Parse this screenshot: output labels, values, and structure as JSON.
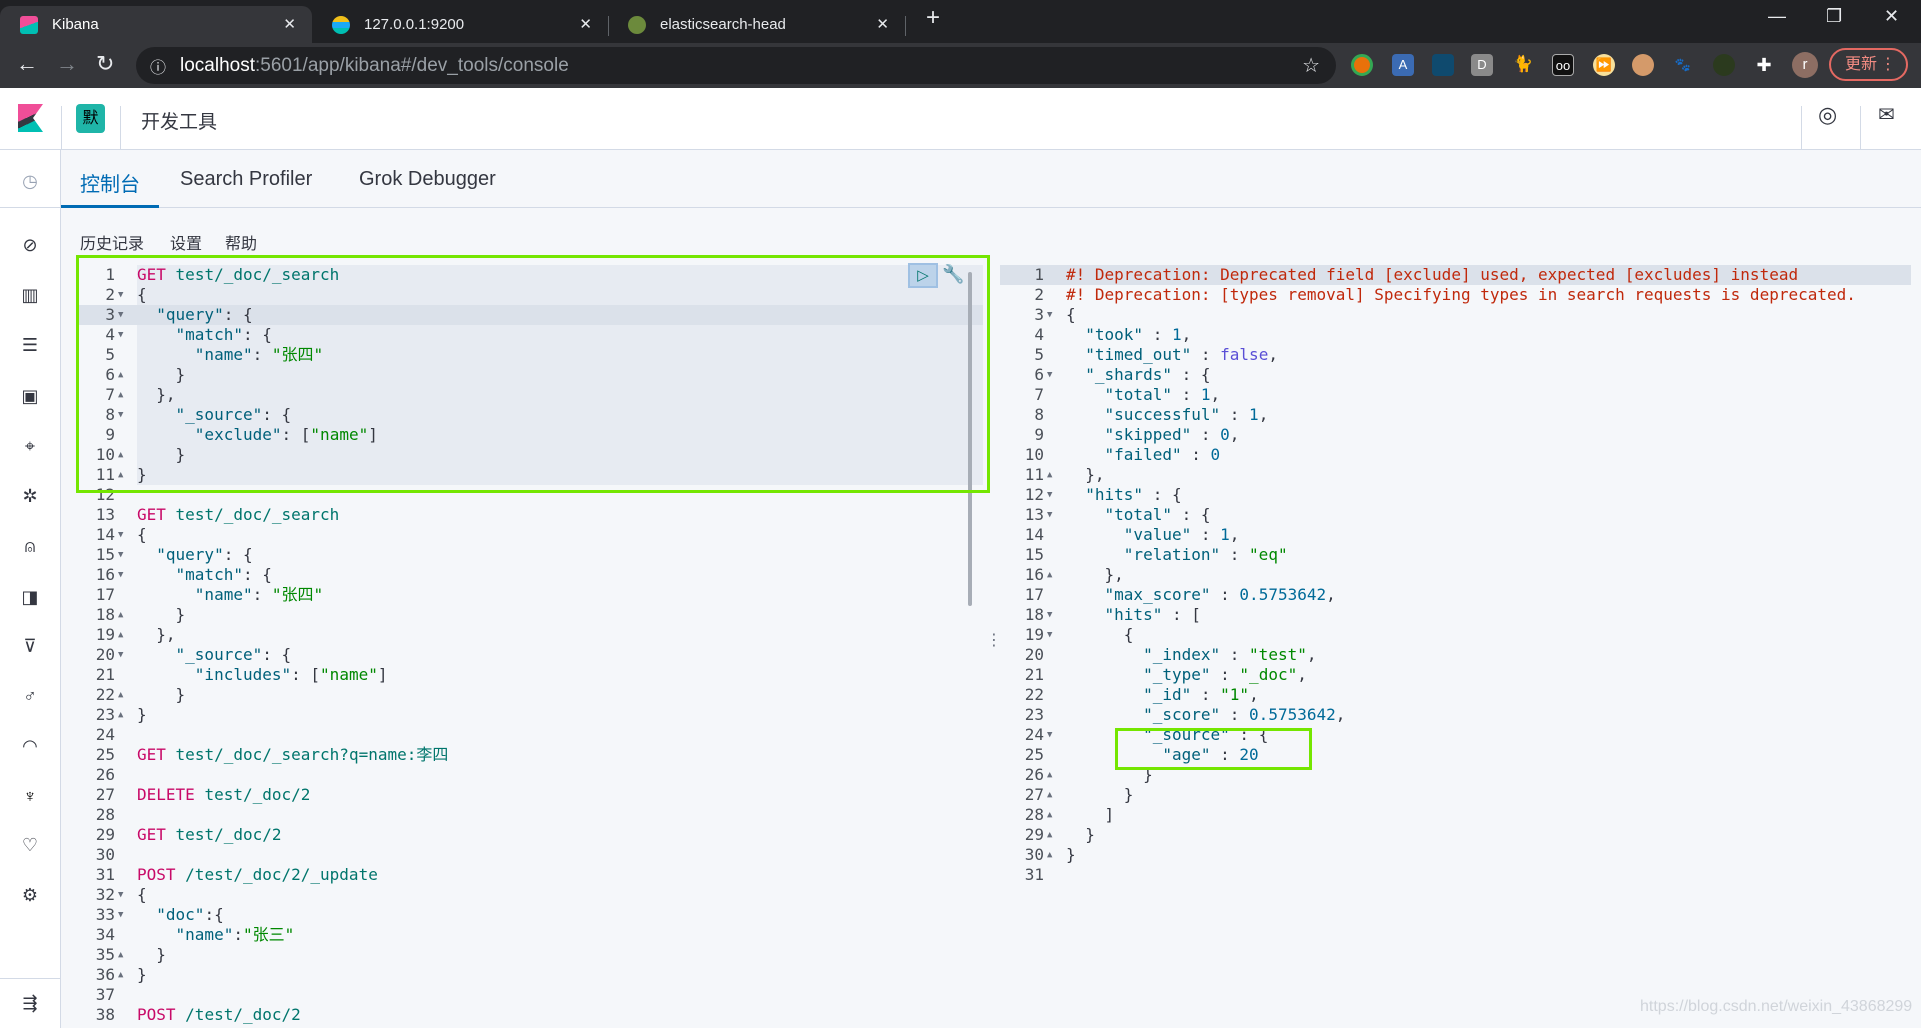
{
  "browser": {
    "tabs": [
      {
        "title": "Kibana",
        "active": true,
        "icon": "kibana-icon"
      },
      {
        "title": "127.0.0.1:9200",
        "icon": "elasticsearch-icon"
      },
      {
        "title": "elasticsearch-head",
        "icon": "es-head-icon"
      }
    ],
    "url_host": "localhost",
    "url_path": ":5601/app/kibana#/dev_tools/console",
    "update_label": "更新",
    "avatar_letter": "r"
  },
  "header": {
    "space_badge": "默",
    "title": "开发工具"
  },
  "tabs": [
    {
      "label": "控制台",
      "active": true
    },
    {
      "label": "Search Profiler"
    },
    {
      "label": "Grok Debugger"
    }
  ],
  "menu": [
    "历史记录",
    "设置",
    "帮助"
  ],
  "colors": {
    "accent": "#006bb4",
    "highlight_box": "#74e600",
    "method": "#c80a68",
    "warning": "#c0290c"
  },
  "editor": {
    "active_line": 3,
    "selected_range": [
      1,
      11
    ],
    "lines": [
      {
        "t": "GET test/_doc/_search"
      },
      {
        "t": "{",
        "f": "o"
      },
      {
        "t": "  \"query\": {",
        "f": "o"
      },
      {
        "t": "    \"match\": {",
        "f": "o"
      },
      {
        "t": "      \"name\": \"张四\""
      },
      {
        "t": "    }",
        "f": "c"
      },
      {
        "t": "  },",
        "f": "c"
      },
      {
        "t": "    \"_source\": {",
        "f": "o"
      },
      {
        "t": "      \"exclude\": [\"name\"]"
      },
      {
        "t": "    }",
        "f": "c"
      },
      {
        "t": "}",
        "f": "c"
      },
      {
        "t": ""
      },
      {
        "t": "GET test/_doc/_search"
      },
      {
        "t": "{",
        "f": "o"
      },
      {
        "t": "  \"query\": {",
        "f": "o"
      },
      {
        "t": "    \"match\": {",
        "f": "o"
      },
      {
        "t": "      \"name\": \"张四\""
      },
      {
        "t": "    }",
        "f": "c"
      },
      {
        "t": "  },",
        "f": "c"
      },
      {
        "t": "    \"_source\": {",
        "f": "o"
      },
      {
        "t": "      \"includes\": [\"name\"]"
      },
      {
        "t": "    }",
        "f": "c"
      },
      {
        "t": "}",
        "f": "c"
      },
      {
        "t": ""
      },
      {
        "t": "GET test/_doc/_search?q=name:李四"
      },
      {
        "t": ""
      },
      {
        "t": "DELETE test/_doc/2"
      },
      {
        "t": ""
      },
      {
        "t": "GET test/_doc/2"
      },
      {
        "t": ""
      },
      {
        "t": "POST /test/_doc/2/_update"
      },
      {
        "t": "{",
        "f": "o"
      },
      {
        "t": "  \"doc\":{",
        "f": "o"
      },
      {
        "t": "    \"name\":\"张三\""
      },
      {
        "t": "  }",
        "f": "c"
      },
      {
        "t": "}",
        "f": "c"
      },
      {
        "t": ""
      },
      {
        "t": "POST /test/_doc/2"
      }
    ]
  },
  "output": {
    "lines": [
      {
        "t": "#! Deprecation: Deprecated field [exclude] used, expected [excludes] instead"
      },
      {
        "t": "#! Deprecation: [types removal] Specifying types in search requests is deprecated."
      },
      {
        "t": "{",
        "f": "o"
      },
      {
        "t": "  \"took\" : 1,"
      },
      {
        "t": "  \"timed_out\" : false,"
      },
      {
        "t": "  \"_shards\" : {",
        "f": "o"
      },
      {
        "t": "    \"total\" : 1,"
      },
      {
        "t": "    \"successful\" : 1,"
      },
      {
        "t": "    \"skipped\" : 0,"
      },
      {
        "t": "    \"failed\" : 0"
      },
      {
        "t": "  },",
        "f": "c"
      },
      {
        "t": "  \"hits\" : {",
        "f": "o"
      },
      {
        "t": "    \"total\" : {",
        "f": "o"
      },
      {
        "t": "      \"value\" : 1,"
      },
      {
        "t": "      \"relation\" : \"eq\""
      },
      {
        "t": "    },",
        "f": "c"
      },
      {
        "t": "    \"max_score\" : 0.5753642,"
      },
      {
        "t": "    \"hits\" : [",
        "f": "o"
      },
      {
        "t": "      {",
        "f": "o"
      },
      {
        "t": "        \"_index\" : \"test\","
      },
      {
        "t": "        \"_type\" : \"_doc\","
      },
      {
        "t": "        \"_id\" : \"1\","
      },
      {
        "t": "        \"_score\" : 0.5753642,"
      },
      {
        "t": "        \"_source\" : {",
        "f": "o"
      },
      {
        "t": "          \"age\" : 20"
      },
      {
        "t": "        }",
        "f": "c"
      },
      {
        "t": "      }",
        "f": "c"
      },
      {
        "t": "    ]",
        "f": "c"
      },
      {
        "t": "  }",
        "f": "c"
      },
      {
        "t": "}",
        "f": "c"
      },
      {
        "t": ""
      }
    ]
  },
  "watermark": "https://blog.csdn.net/weixin_43868299"
}
